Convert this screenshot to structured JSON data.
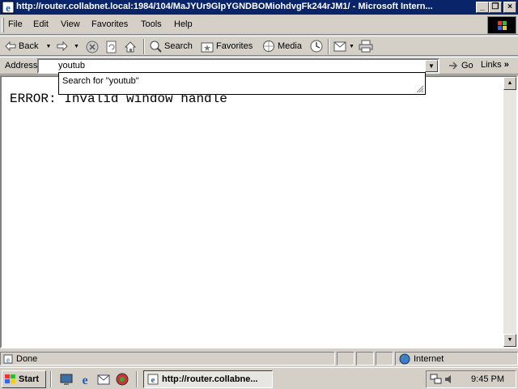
{
  "window": {
    "title": "http://router.collabnet.local:1984/104/MaJYUr9GlpYGNDBOMiohdvgFk244rJM1/ - Microsoft Intern..."
  },
  "menu": {
    "items": [
      "File",
      "Edit",
      "View",
      "Favorites",
      "Tools",
      "Help"
    ]
  },
  "toolbar": {
    "back_label": "Back",
    "search_label": "Search",
    "favorites_label": "Favorites",
    "media_label": "Media"
  },
  "address": {
    "label": "Address",
    "value": "youtub",
    "go_label": "Go",
    "links_label": "Links"
  },
  "autocomplete": {
    "item": "Search for \"youtub\""
  },
  "content": {
    "text": "ERROR: Invalid window handle"
  },
  "status": {
    "text": "Done",
    "zone": "Internet"
  },
  "taskbar": {
    "start_label": "Start",
    "task_label": "http://router.collabne...",
    "clock": "9:45 PM"
  },
  "colors": {
    "titlebar": "#0a246a",
    "face": "#d4d0c8"
  }
}
